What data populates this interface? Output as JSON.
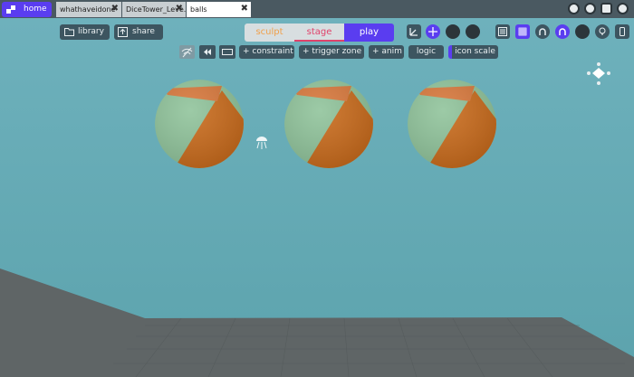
{
  "tabs": {
    "home": "home",
    "items": [
      "whathaveidone",
      "DiceTower_Leve...",
      "balls"
    ],
    "close_glyph": "✖"
  },
  "toolbar": {
    "library": "library",
    "share": "share",
    "modes": [
      "sculpt",
      "stage",
      "play"
    ],
    "active_mode": "play",
    "constraint": "+ constraint",
    "trigger_zone": "+ trigger zone",
    "anim": "+ anim",
    "logic": "logic",
    "icon_scale": "icon scale"
  },
  "colors": {
    "accent": "#5a3df0",
    "sculpt": "#f0a04b",
    "stage": "#e0426a",
    "sky": "#6aaeb8",
    "ground": "#5f6566",
    "ball_green": "#8fc39a",
    "ball_orange": "#c96a1a"
  },
  "icons": [
    "home-logo-icon",
    "speedometer-icon",
    "gear-icon",
    "discord-icon",
    "help-icon",
    "move-axes-icon",
    "move-arrows-icon",
    "list-icon",
    "grid-icon",
    "magnet-icon",
    "arch-icon",
    "lightbulb-icon",
    "phone-icon",
    "wifi-icon",
    "rewind-icon",
    "keyboard-icon",
    "viewcube-icon",
    "light-icon"
  ]
}
